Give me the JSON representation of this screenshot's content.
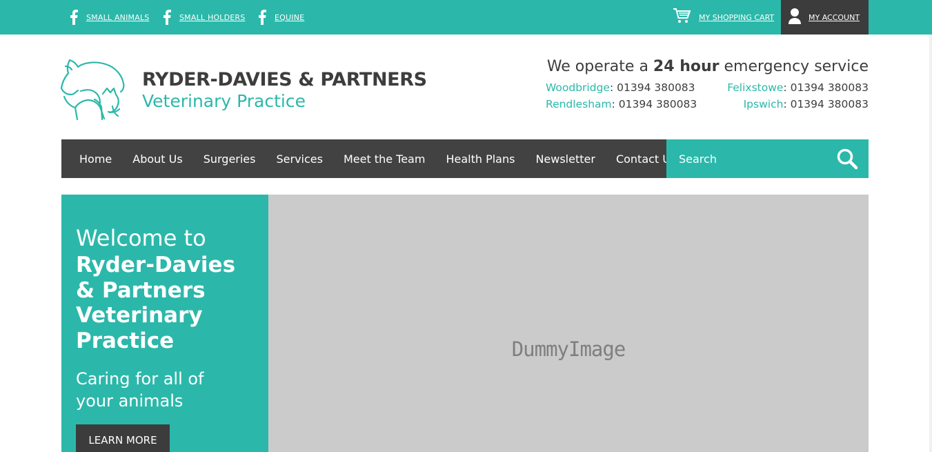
{
  "topbar": {
    "social_links": [
      {
        "label": "SMALL ANIMALS",
        "icon": "facebook-icon"
      },
      {
        "label": "SMALL HOLDERS",
        "icon": "facebook-icon"
      },
      {
        "label": "EQUINE",
        "icon": "facebook-icon"
      }
    ],
    "cart_label": "MY SHOPPING CART",
    "account_label": "MY ACCOUNT"
  },
  "header": {
    "brand_name": "RYDER-DAVIES & PARTNERS",
    "brand_sub": "Veterinary Practice",
    "emergency_pre": "We operate a ",
    "emergency_bold": "24 hour",
    "emergency_post": " emergency service",
    "branches": [
      {
        "name": "Woodbridge",
        "phone": ": 01394 380083"
      },
      {
        "name": "Felixstowe",
        "phone": ": 01394 380083"
      },
      {
        "name": "Rendlesham",
        "phone": ": 01394 380083"
      },
      {
        "name": "Ipswich",
        "phone": ": 01394 380083"
      }
    ]
  },
  "nav": {
    "items": [
      "Home",
      "About Us",
      "Surgeries",
      "Services",
      "Meet the Team",
      "Health Plans",
      "Newsletter",
      "Contact Us"
    ],
    "search_placeholder": "Search"
  },
  "hero": {
    "welcome": "Welcome to",
    "title": "Ryder-Davies & Partners Veterinary Practice",
    "tagline": "Caring for all of your animals",
    "button": "LEARN MORE",
    "image_text": "DummyImage"
  },
  "colors": {
    "teal": "#2bb8aa",
    "dark": "#3c3c3c",
    "nav": "#424242",
    "image_bg": "#cbcbcb"
  }
}
